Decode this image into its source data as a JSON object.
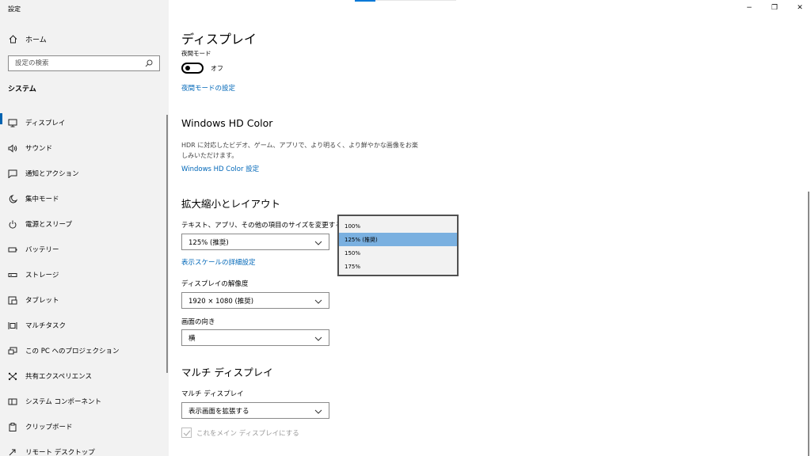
{
  "window": {
    "title": "設定",
    "minimize": "−",
    "restore": "❐",
    "close": "✕"
  },
  "sidebar": {
    "home_label": "ホーム",
    "search_placeholder": "設定の検索",
    "section_title": "システム",
    "items": [
      {
        "label": "ディスプレイ",
        "icon": "monitor-icon",
        "active": true
      },
      {
        "label": "サウンド",
        "icon": "speaker-icon"
      },
      {
        "label": "通知とアクション",
        "icon": "notification-icon"
      },
      {
        "label": "集中モード",
        "icon": "moon-icon"
      },
      {
        "label": "電源とスリープ",
        "icon": "power-icon"
      },
      {
        "label": "バッテリー",
        "icon": "battery-icon"
      },
      {
        "label": "ストレージ",
        "icon": "storage-icon"
      },
      {
        "label": "タブレット",
        "icon": "tablet-icon"
      },
      {
        "label": "マルチタスク",
        "icon": "multitask-icon"
      },
      {
        "label": "この PC へのプロジェクション",
        "icon": "projection-icon"
      },
      {
        "label": "共有エクスペリエンス",
        "icon": "shared-experience-icon"
      },
      {
        "label": "システム コンポーネント",
        "icon": "components-icon"
      },
      {
        "label": "クリップボード",
        "icon": "clipboard-icon"
      },
      {
        "label": "リモート デスクトップ",
        "icon": "remote-desktop-icon"
      }
    ]
  },
  "main": {
    "title": "ディスプレイ",
    "night_mode": {
      "label": "夜間モード",
      "state": "オフ",
      "settings_link": "夜間モードの設定"
    },
    "hdr": {
      "heading": "Windows HD Color",
      "description": "HDR に対応したビデオ、ゲーム、アプリで、より明るく、より鮮やかな画像をお楽しみいただけます。",
      "link": "Windows HD Color 設定"
    },
    "scale_layout": {
      "heading": "拡大縮小とレイアウト",
      "scale_label": "テキスト、アプリ、その他の項目のサイズを変更する",
      "scale_value": "125% (推奨)",
      "advanced_link": "表示スケールの詳細設定",
      "resolution_label": "ディスプレイの解像度",
      "resolution_value": "1920 × 1080 (推奨)",
      "orientation_label": "画面の向き",
      "orientation_value": "横"
    },
    "multi_display": {
      "heading": "マルチ ディスプレイ",
      "label": "マルチ ディスプレイ",
      "value": "表示画面を拡張する",
      "checkbox_label": "これをメイン ディスプレイにする",
      "checkbox_checked": true,
      "checkbox_disabled": true
    }
  },
  "scale_dropdown": {
    "options": [
      "100%",
      "125% (推奨)",
      "150%",
      "175%"
    ],
    "selected_index": 1
  },
  "colors": {
    "accent": "#0078d7",
    "link": "#0067b8",
    "sidebar_bg": "#f2f2f2",
    "selected_option_bg": "#7ab0e0"
  }
}
